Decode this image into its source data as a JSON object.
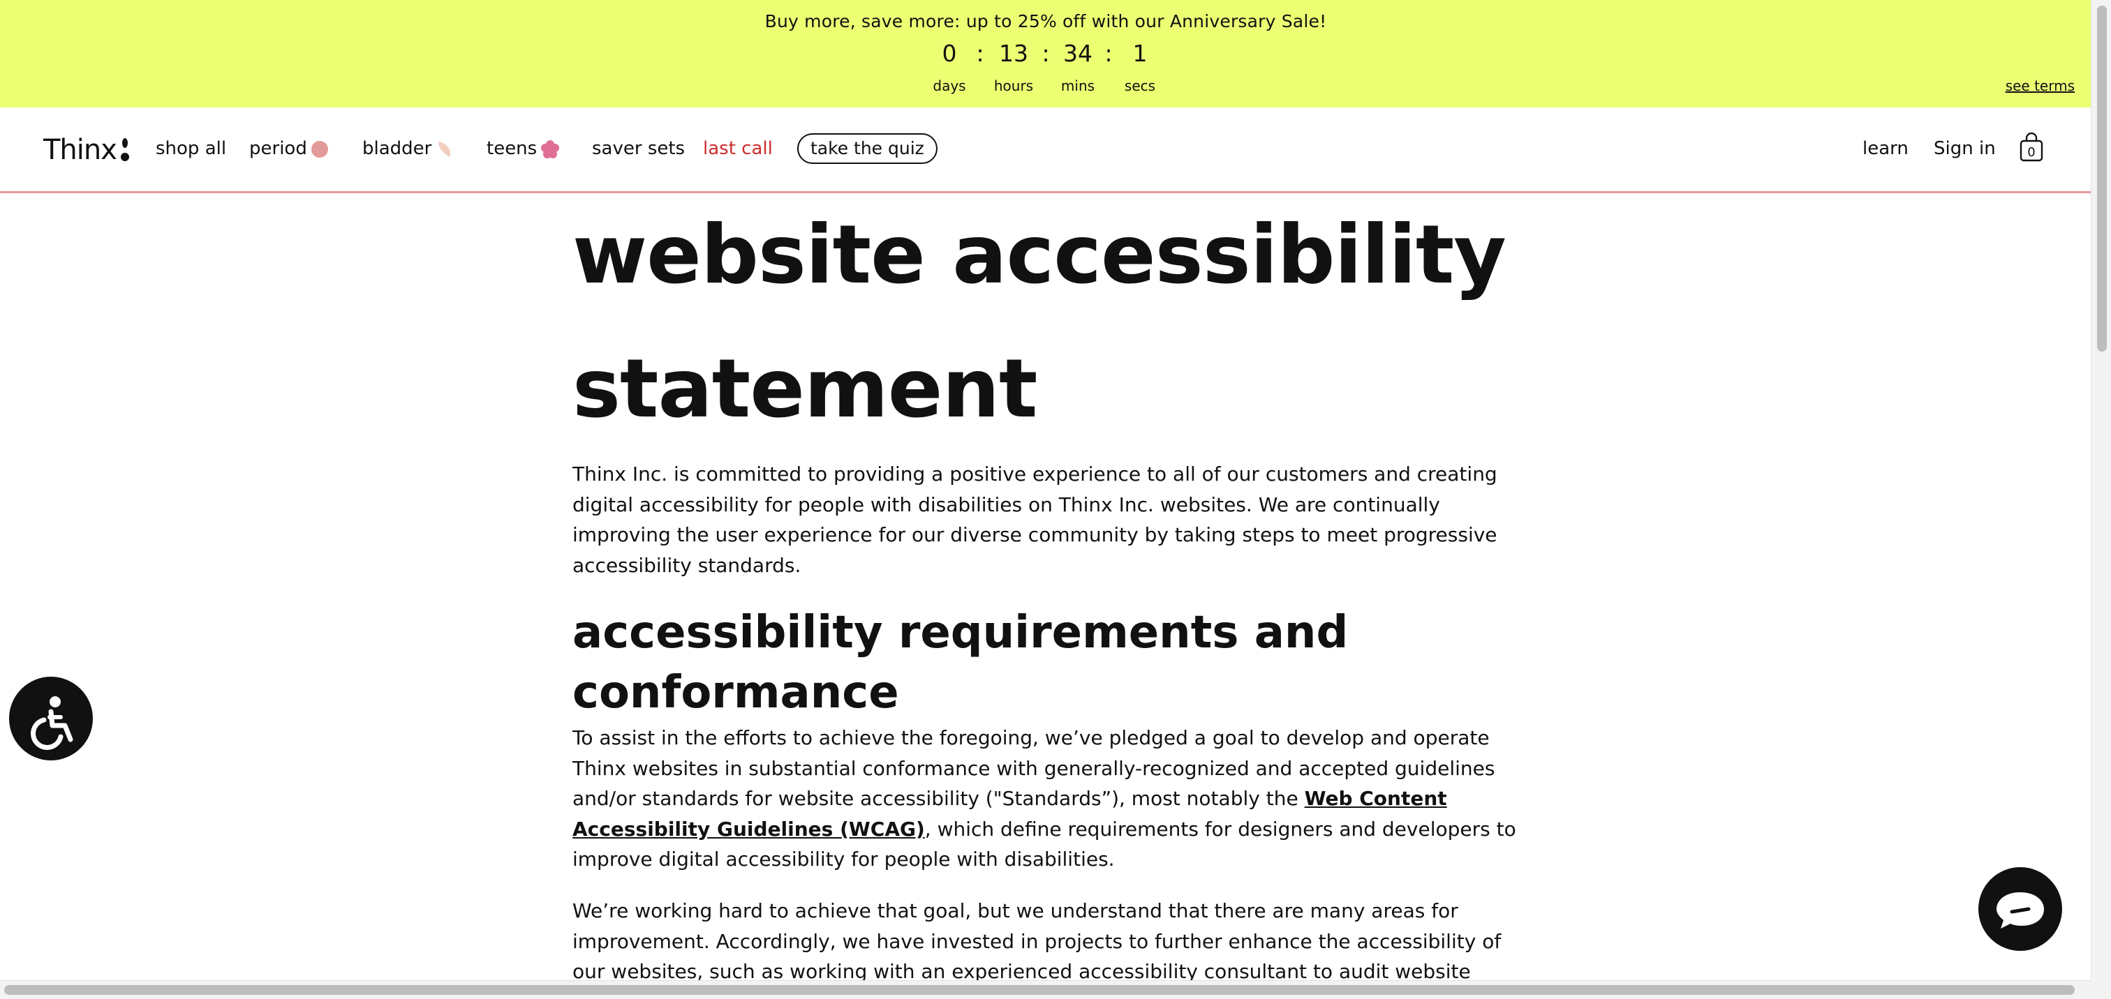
{
  "promo": {
    "text": "Buy more, save more: up to 25% off with our  Anniversary Sale!",
    "countdown": {
      "days": "0",
      "hours": "13",
      "mins": "34",
      "secs": "1",
      "separator": ":",
      "days_label": "days",
      "hours_label": "hours",
      "mins_label": "mins",
      "secs_label": "secs"
    },
    "see_terms": "see terms",
    "background": "#ebff73"
  },
  "nav": {
    "logo": "Thinx",
    "links": {
      "shop_all": "shop all",
      "period": "period",
      "bladder": "bladder",
      "teens": "teens",
      "saver_sets": "saver sets",
      "last_call": "last call"
    },
    "quiz_button": "take the quiz",
    "learn": "learn",
    "sign_in": "Sign in",
    "cart_count": "0",
    "icons": {
      "period": "circle-icon",
      "bladder": "crescent-icon",
      "teens": "flower-icon",
      "cart": "shopping-bag-icon"
    },
    "accent_color": "#cf2b2b",
    "underline_color": "#e69a9a"
  },
  "main": {
    "title_line1": "website accessibility",
    "title_line2": "statement",
    "intro": "Thinx Inc. is committed to providing a positive experience to all of our customers and creating digital accessibility for people with disabilities on Thinx Inc. websites. We are continually improving the user experience for our diverse community by taking steps to meet progressive accessibility standards.",
    "section_title": "accessibility requirements and conformance",
    "section_p1_before": "To assist in the efforts to achieve the foregoing, we’ve pledged a goal to develop and operate Thinx websites in substantial conformance with generally-recognized and accepted guidelines and/or standards for website accessibility (\"Standards”), most notably the ",
    "section_p1_link": "Web Content Accessibility Guidelines (WCAG)",
    "section_p1_after": ", which define requirements for designers and developers to improve digital accessibility for people with disabilities.",
    "section_p2": "We’re working hard to achieve that goal, but we understand that there are many areas for improvement. Accordingly, we have invested in projects to further enhance the accessibility of our websites, such as working with an experienced accessibility consultant to audit website"
  },
  "widgets": {
    "accessibility_icon": "wheelchair-icon",
    "chat_icon": "chat-bubble-icon"
  }
}
